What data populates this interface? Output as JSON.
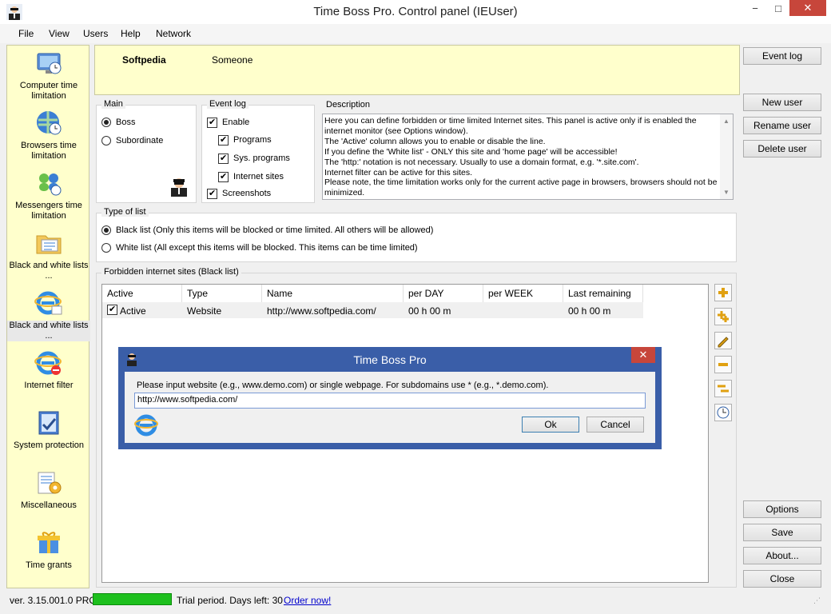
{
  "window": {
    "title": "Time Boss Pro. Control panel (IEUser)",
    "min": "−",
    "max": "□",
    "close": "✕"
  },
  "menu": [
    "File",
    "View",
    "Users",
    "Help",
    "Network"
  ],
  "sidebar": {
    "items": [
      {
        "label": "Computer time limitation",
        "icon": "monitor-clock-icon"
      },
      {
        "label": "Browsers time limitation",
        "icon": "globe-clock-icon"
      },
      {
        "label": "Messengers time limitation",
        "icon": "messengers-icon"
      },
      {
        "label": "Black and white lists ...",
        "icon": "folder-list-icon"
      },
      {
        "label": "Black and white lists ...",
        "icon": "ie-list-icon"
      },
      {
        "label": "Internet filter",
        "icon": "ie-filter-icon"
      },
      {
        "label": "System protection",
        "icon": "shield-icon"
      },
      {
        "label": "Miscellaneous",
        "icon": "misc-icon"
      },
      {
        "label": "Time grants",
        "icon": "gift-icon"
      }
    ]
  },
  "header": {
    "product": "Softpedia",
    "user": "Someone"
  },
  "main_group": {
    "title": "Main",
    "boss": "Boss",
    "subordinate": "Subordinate"
  },
  "event_log": {
    "title": "Event log",
    "enable": "Enable",
    "programs": "Programs",
    "sys_programs": "Sys. programs",
    "internet_sites": "Internet sites",
    "screenshots": "Screenshots"
  },
  "description": {
    "title": "Description",
    "text": "Here you can define forbidden or time limited Internet sites. This panel is active only if is enabled the internet monitor (see Options window).\nThe 'Active' column allows you to enable or disable the line.\nIf you define the 'White list' - ONLY this site and 'home page' will be accessible!\nThe 'http:' notation is not necessary. Usually to use a domain format, e.g. '*.site.com'.\nInternet filter can be active for this sites.\nPlease note, the time limitation works only for the current active page in browsers, browsers should not be minimized."
  },
  "type_of_list": {
    "title": "Type of list",
    "black": "Black list (Only this items will be blocked or time limited. All others will be allowed)",
    "white": "White list (All except this items will be blocked. This items can be time limited)"
  },
  "sites": {
    "title": "Forbidden internet sites (Black list)",
    "columns": [
      "Active",
      "Type",
      "Name",
      "per DAY",
      "per WEEK",
      "Last remaining ti..."
    ],
    "rows": [
      {
        "active": "Active",
        "type": "Website",
        "name": "http://www.softpedia.com/",
        "per_day": "00 h 00 m",
        "per_week": "",
        "last": "00 h 00 m"
      }
    ]
  },
  "right_buttons": {
    "event_log": "Event log",
    "new_user": "New user",
    "rename_user": "Rename user",
    "delete_user": "Delete user",
    "options": "Options",
    "save": "Save",
    "about": "About...",
    "close": "Close"
  },
  "dialog": {
    "title": "Time Boss Pro",
    "prompt": "Please input website (e.g., www.demo.com) or single webpage. For subdomains use * (e.g., *.demo.com).",
    "value": "http://www.softpedia.com/",
    "ok": "Ok",
    "cancel": "Cancel"
  },
  "status": {
    "version": "ver. 3.15.001.0 PRO",
    "trial": "Trial period. Days left: 30",
    "order": "Order now!",
    "accent": "#1ec01e"
  }
}
